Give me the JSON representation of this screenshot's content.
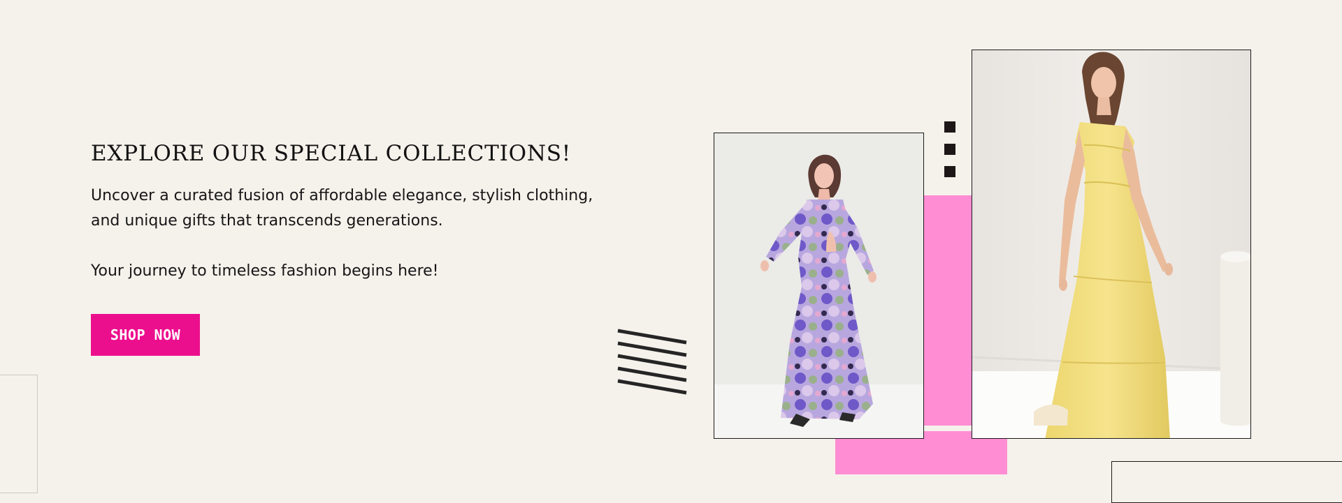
{
  "hero": {
    "title": "EXPLORE OUR SPECIAL COLLECTIONS!",
    "description": "Uncover a curated fusion of affordable elegance, stylish clothing, and unique gifts that transcends generations.",
    "tagline": "Your journey to timeless fashion begins here!",
    "button_label": "SHOP NOW"
  },
  "colors": {
    "background": "#f5f1eb",
    "button": "#ec0f8d",
    "accent_pink": "#ff8dd3",
    "text": "#111111"
  },
  "images": {
    "floral_dress": "floral-maxi-dress-photo",
    "yellow_dress": "yellow-maxi-dress-photo"
  },
  "decorations": {
    "stripe_icon": "diagonal-stripes-icon",
    "square_icon": "square-dots-icon"
  }
}
